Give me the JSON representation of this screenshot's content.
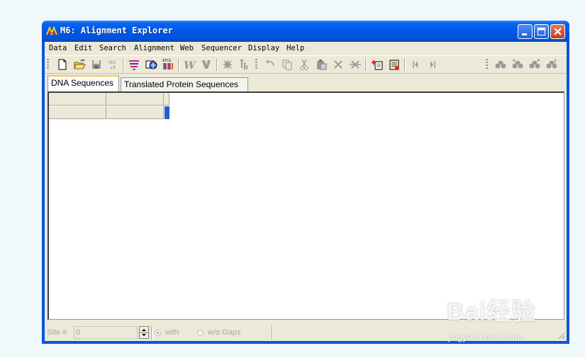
{
  "window": {
    "title": "M6: Alignment Explorer",
    "title_prefix": "M6:",
    "title_rest": " Alignment Explorer"
  },
  "menu": [
    "Data",
    "Edit",
    "Search",
    "Alignment",
    "Web",
    "Sequencer",
    "Display",
    "Help"
  ],
  "tabs": [
    {
      "label": "DNA Sequences",
      "active": true
    },
    {
      "label": "Translated Protein Sequences",
      "active": false
    }
  ],
  "toolbar": {
    "buttons": [
      "new-document-icon",
      "open-folder-icon",
      "save-icon",
      "translate-codon-icon",
      "align-sequences-icon",
      "web-browser-icon",
      "genbank-query-icon",
      "weight-icon",
      "muscle-icon",
      "mark-site-icon",
      "trace-icon",
      "undo-icon",
      "copy-icon",
      "cut-icon",
      "paste-icon",
      "delete-icon",
      "delete-gap-icon",
      "add-sequence-icon",
      "add-file-icon",
      "scroll-left-icon",
      "scroll-right-icon",
      "find-icon",
      "find-previous-icon",
      "find-next-icon",
      "find-motif-icon"
    ]
  },
  "status": {
    "site_label": "Site #",
    "site_value": "0",
    "with_label": "with",
    "without_label": "w/o Gaps",
    "with_selected": true
  },
  "watermark": {
    "main": "Bai经验",
    "sub": "jingyan.baidu.com"
  },
  "colors": {
    "titlebar": "#0058e6",
    "client_bg": "#ece9d8",
    "cursor": "#2a58d8",
    "tab_highlight": "#ffc83c"
  }
}
